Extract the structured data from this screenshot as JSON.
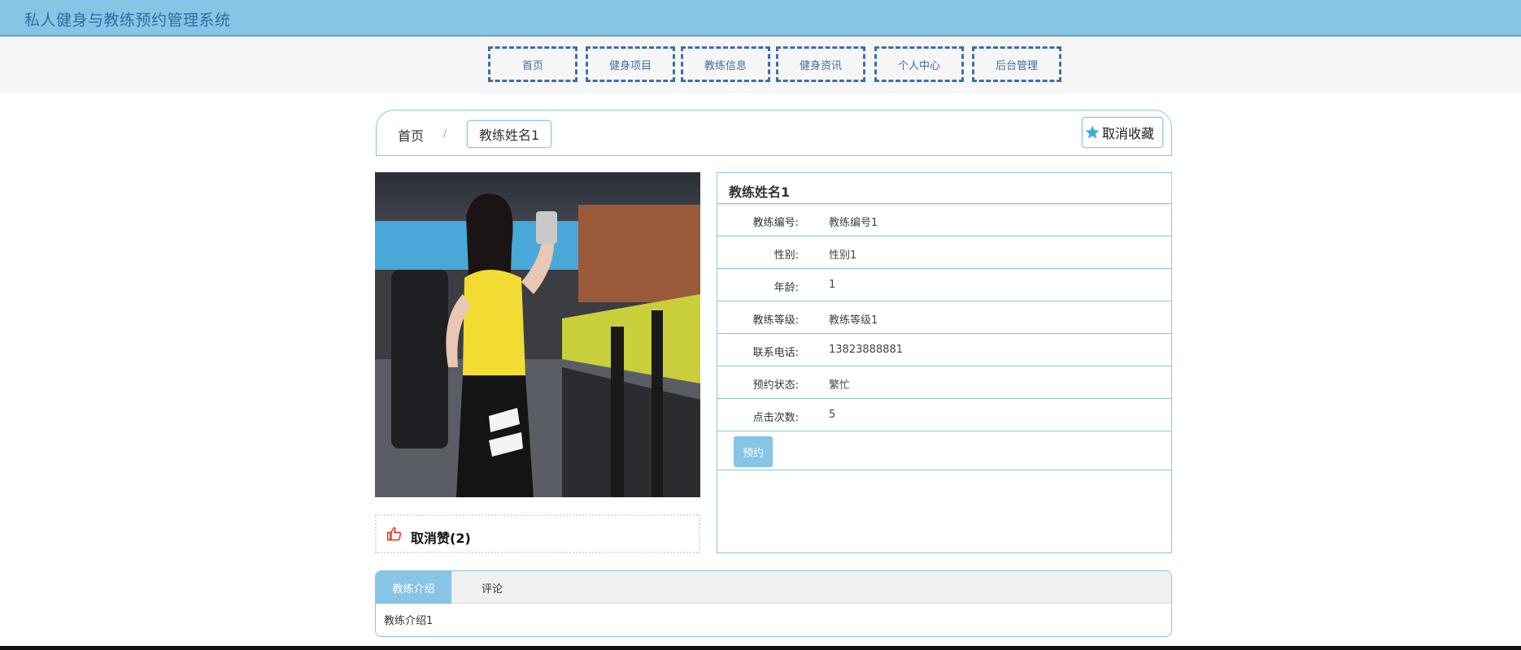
{
  "app": {
    "title": "私人健身与教练预约管理系统"
  },
  "nav": [
    "首页",
    "健身项目",
    "教练信息",
    "健身资讯",
    "个人中心",
    "后台管理"
  ],
  "breadcrumb": {
    "home": "首页",
    "separator": "/",
    "current": "教练姓名1"
  },
  "favorite": {
    "label": "取消收藏",
    "icon": "star-icon"
  },
  "like": {
    "label": "取消赞(2)",
    "icon": "thumbs-up-icon"
  },
  "detail": {
    "name": "教练姓名1",
    "rows": [
      {
        "key": "教练编号:",
        "value": "教练编号1"
      },
      {
        "key": "性别:",
        "value": "性别1"
      },
      {
        "key": "年龄:",
        "value": "1"
      },
      {
        "key": "教练等级:",
        "value": "教练等级1"
      },
      {
        "key": "联系电话:",
        "value": "13823888881"
      },
      {
        "key": "预约状态:",
        "value": "繁忙"
      },
      {
        "key": "点击次数:",
        "value": "5"
      }
    ],
    "book_label": "预约"
  },
  "tabs": {
    "active": "教练介绍",
    "other": "评论",
    "content": "教练介绍1"
  },
  "colors": {
    "accent": "#87c4e6",
    "nav_border": "#3f6ea8",
    "title_text": "#2f6ea3"
  }
}
